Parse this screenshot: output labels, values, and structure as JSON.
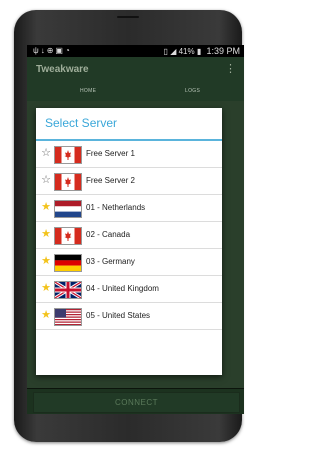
{
  "status_bar": {
    "icons_left": [
      "usb-icon",
      "download-icon",
      "vpn-icon",
      "image-icon",
      "wifi-icon"
    ],
    "icons_right": [
      "vibrate-icon",
      "signal-icon"
    ],
    "battery": "41%",
    "time": "1:39 PM"
  },
  "app_bar": {
    "title": "Tweakware",
    "menu_icon": "overflow-menu-icon"
  },
  "tabs": [
    {
      "label": "HOME"
    },
    {
      "label": "LOGS"
    }
  ],
  "dialog": {
    "title": "Select Server",
    "servers": [
      {
        "label": "Free Server 1",
        "flag": "canada",
        "starred": false
      },
      {
        "label": "Free Server 2",
        "flag": "canada",
        "starred": false
      },
      {
        "label": "01 - Netherlands",
        "flag": "netherlands",
        "starred": true
      },
      {
        "label": "02 - Canada",
        "flag": "canada",
        "starred": true
      },
      {
        "label": "03 - Germany",
        "flag": "germany",
        "starred": true
      },
      {
        "label": "04 - United Kingdom",
        "flag": "united-kingdom",
        "starred": true
      },
      {
        "label": "05 - United States",
        "flag": "united-states",
        "starred": true
      }
    ]
  },
  "connect_button": {
    "label": "CONNECT"
  },
  "colors": {
    "accent": "#3aa7d9",
    "app_bar": "#213a26",
    "star_filled": "#f3c31b"
  }
}
